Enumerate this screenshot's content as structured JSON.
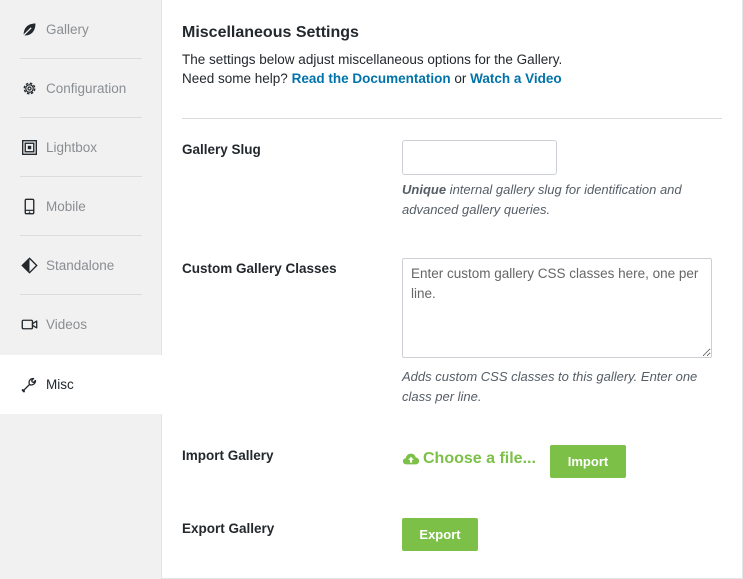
{
  "sidebar": {
    "items": [
      {
        "label": "Gallery",
        "icon": "leaf-icon"
      },
      {
        "label": "Configuration",
        "icon": "gear-icon"
      },
      {
        "label": "Lightbox",
        "icon": "lightbox-icon"
      },
      {
        "label": "Mobile",
        "icon": "mobile-icon"
      },
      {
        "label": "Standalone",
        "icon": "standalone-icon"
      },
      {
        "label": "Videos",
        "icon": "video-icon"
      },
      {
        "label": "Misc",
        "icon": "wrench-icon",
        "active": true
      }
    ]
  },
  "main": {
    "title": "Miscellaneous Settings",
    "description": "The settings below adjust miscellaneous options for the Gallery.",
    "help_prefix": "Need some help?",
    "docs_link": "Read the Documentation",
    "or_text": "or",
    "video_link": "Watch a Video",
    "slug": {
      "label": "Gallery Slug",
      "value": "",
      "help_bold": "Unique",
      "help_text": " internal gallery slug for identification and advanced gallery queries."
    },
    "classes": {
      "label": "Custom Gallery Classes",
      "value": "",
      "placeholder": "Enter custom gallery CSS classes here, one per line.",
      "help_text": "Adds custom CSS classes to this gallery. Enter one class per line."
    },
    "import": {
      "label": "Import Gallery",
      "choose_label": "Choose a file...",
      "button_label": "Import"
    },
    "export": {
      "label": "Export Gallery",
      "button_label": "Export"
    }
  },
  "colors": {
    "accent_green": "#7cc048",
    "link_blue": "#0073aa",
    "sidebar_bg": "#f1f1f1"
  }
}
